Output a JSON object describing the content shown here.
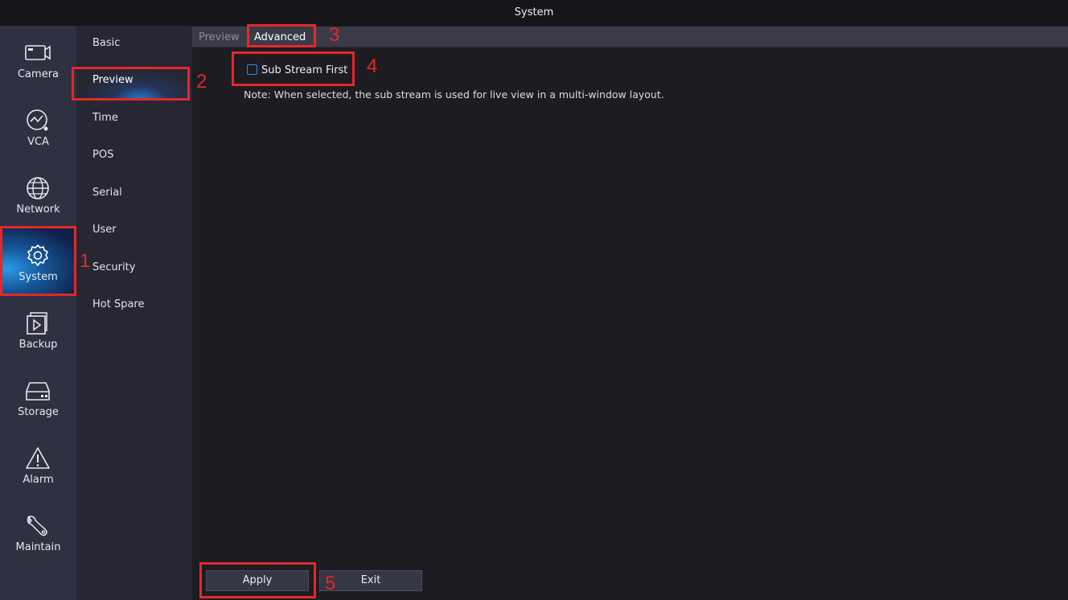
{
  "window": {
    "title": "System"
  },
  "nav_left": [
    {
      "label": "Camera",
      "icon": "camera-icon"
    },
    {
      "label": "VCA",
      "icon": "vca-icon"
    },
    {
      "label": "Network",
      "icon": "globe-icon"
    },
    {
      "label": "System",
      "icon": "gear-icon",
      "active": true
    },
    {
      "label": "Backup",
      "icon": "backup-icon"
    },
    {
      "label": "Storage",
      "icon": "storage-icon"
    },
    {
      "label": "Alarm",
      "icon": "warning-icon"
    },
    {
      "label": "Maintain",
      "icon": "wrench-icon"
    }
  ],
  "nav_sub": [
    "Basic",
    "Preview",
    "Time",
    "POS",
    "Serial",
    "User",
    "Security",
    "Hot Spare"
  ],
  "tabs": [
    "Preview",
    "Advanced"
  ],
  "settings": {
    "sub_stream_label": "Sub Stream First",
    "sub_stream_checked": false,
    "note": "Note: When selected, the sub stream is used for live view in a multi-window layout."
  },
  "buttons": {
    "apply": "Apply",
    "exit": "Exit"
  },
  "annotations": [
    "1",
    "2",
    "3",
    "4",
    "5"
  ],
  "colors": {
    "accent": "#2a8fe6",
    "annotation": "#e52828",
    "sidebar": "#2f3040"
  }
}
